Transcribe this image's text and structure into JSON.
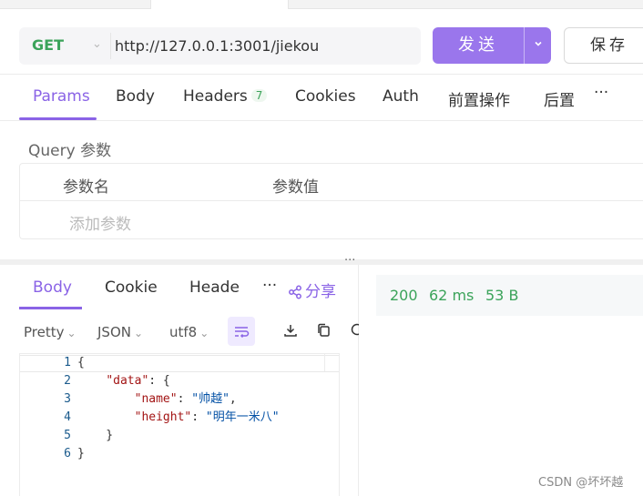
{
  "request": {
    "method": "GET",
    "url": "http://127.0.0.1:3001/jiekou",
    "send_label": "发送",
    "save_label": "保存"
  },
  "request_tabs": [
    {
      "label": "Params",
      "active": true
    },
    {
      "label": "Body"
    },
    {
      "label": "Headers",
      "badge": "7"
    },
    {
      "label": "Cookies"
    },
    {
      "label": "Auth"
    },
    {
      "label": "前置操作"
    },
    {
      "label": "后置"
    }
  ],
  "more_label": "···",
  "query": {
    "section_label": "Query 参数",
    "col_name": "参数名",
    "col_value": "参数值",
    "add_placeholder": "添加参数"
  },
  "splitter_dots": "···",
  "response_tabs": [
    {
      "label": "Body",
      "active": true
    },
    {
      "label": "Cookie"
    },
    {
      "label": "Header"
    }
  ],
  "share_label": "分享",
  "status": {
    "code": "200",
    "time": "62 ms",
    "size": "53 B"
  },
  "format": {
    "view": "Pretty",
    "type": "JSON",
    "encoding": "utf8"
  },
  "code_lines": [
    {
      "n": "1",
      "text": "{"
    },
    {
      "n": "2",
      "text": "    \"data\": {"
    },
    {
      "n": "3",
      "text": "        \"name\": \"帅越\","
    },
    {
      "n": "4",
      "text": "        \"height\": \"明年一米八\""
    },
    {
      "n": "5",
      "text": "    }"
    },
    {
      "n": "6",
      "text": "}"
    }
  ],
  "watermark": "CSDN @坏坏越",
  "colors": {
    "accent": "#8a63e6",
    "send": "#9a76ec",
    "success": "#3ba35a"
  }
}
